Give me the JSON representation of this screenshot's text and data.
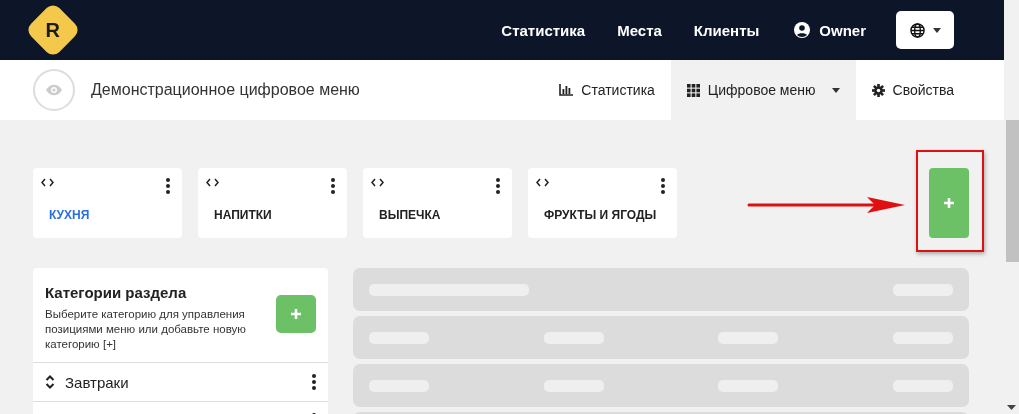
{
  "navbar": {
    "logo": "R",
    "links": [
      {
        "label": "Статистика"
      },
      {
        "label": "Места"
      },
      {
        "label": "Клиенты"
      }
    ],
    "user": "Owner"
  },
  "subheader": {
    "title": "Демонстрационное цифровое меню",
    "tabs": [
      {
        "label": "Статистика",
        "selected": false,
        "dropdown": false
      },
      {
        "label": "Цифровое меню",
        "selected": true,
        "dropdown": true
      },
      {
        "label": "Свойства",
        "selected": false,
        "dropdown": false
      }
    ]
  },
  "sections": [
    {
      "label": "КУХНЯ",
      "selected": true
    },
    {
      "label": "НАПИТКИ",
      "selected": false
    },
    {
      "label": "ВЫПЕЧКА",
      "selected": false
    },
    {
      "label": "ФРУКТЫ И ЯГОДЫ",
      "selected": false
    }
  ],
  "categories": {
    "title": "Категории раздела",
    "description": "Выберите категорию для управления позициями меню или добавьте новую категорию [+]",
    "items": [
      {
        "label": "Завтраки"
      }
    ]
  }
}
